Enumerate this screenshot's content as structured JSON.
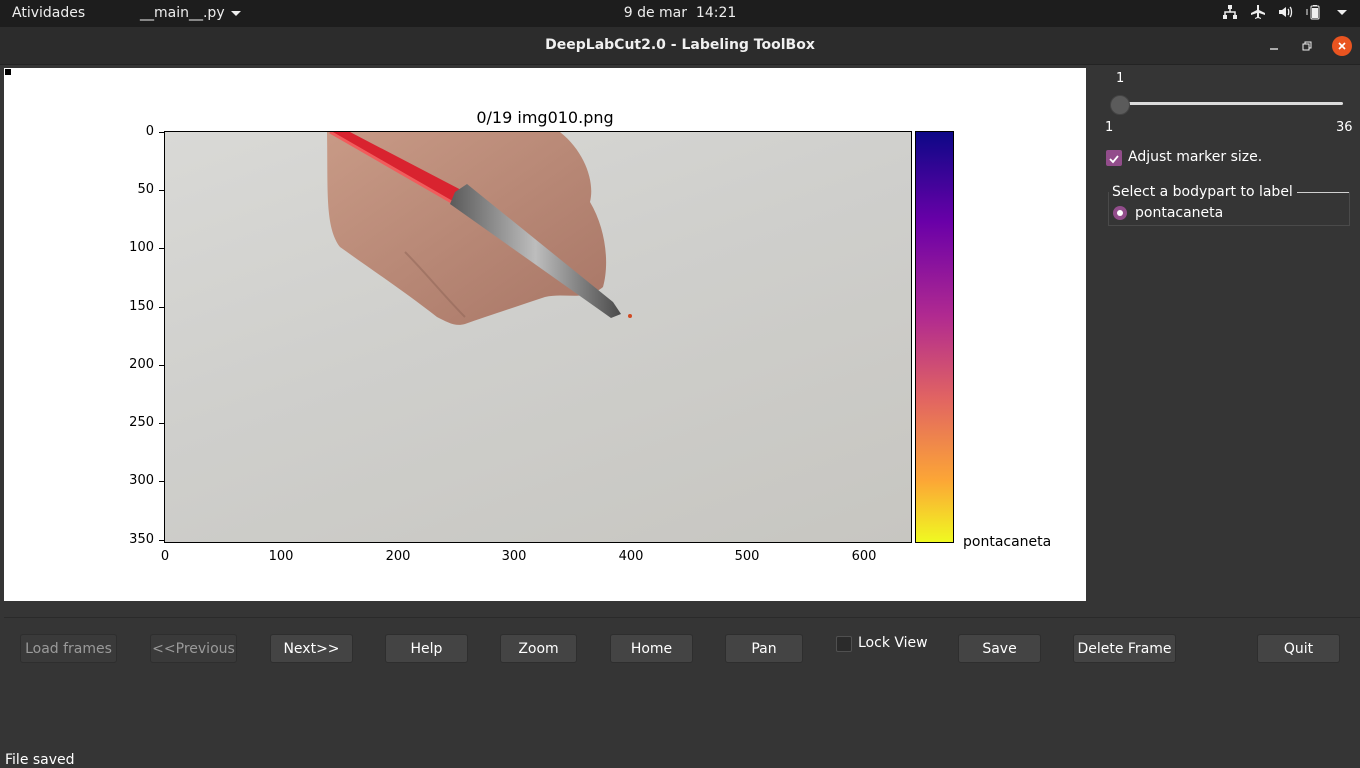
{
  "topbar": {
    "activities": "Atividades",
    "app_menu": "__main__.py",
    "date": "9 de mar",
    "time": "14:21",
    "tray_icons": [
      "network-icon",
      "airplane-icon",
      "volume-icon",
      "battery-icon",
      "system-menu-icon"
    ]
  },
  "window": {
    "title": "DeepLabCut2.0 - Labeling ToolBox"
  },
  "figure": {
    "title": "0/19 img010.png",
    "colorbar_label": "pontacaneta",
    "colormap": "plasma",
    "image_description_icon": "hand-with-pen-image"
  },
  "chart_data": {
    "type": "heatmap",
    "title": "0/19 img010.png",
    "xlabel": "",
    "ylabel": "",
    "x_ticks": [
      "0",
      "100",
      "200",
      "300",
      "400",
      "500",
      "600"
    ],
    "y_ticks": [
      "0",
      "50",
      "100",
      "150",
      "200",
      "250",
      "300",
      "350"
    ],
    "xlim": [
      0,
      640
    ],
    "ylim": [
      360,
      0
    ],
    "colorbar_labels": [
      "pontacaneta"
    ]
  },
  "side_panel": {
    "slider_value": "1",
    "slider_min": "1",
    "slider_max": "36",
    "slider_fraction": 0,
    "adjust_marker_label": "Adjust marker size.",
    "adjust_marker_checked": true,
    "bodypart_group_title": "Select a bodypart to label",
    "bodyparts": [
      {
        "label": "pontacaneta",
        "selected": true
      }
    ]
  },
  "buttons": {
    "load_frames": "Load frames",
    "previous": "<<Previous",
    "next": "Next>>",
    "help": "Help",
    "zoom": "Zoom",
    "home": "Home",
    "pan": "Pan",
    "lock_view": "Lock View",
    "save": "Save",
    "delete_frame": "Delete Frame",
    "quit": "Quit"
  },
  "status": {
    "text": "File saved"
  },
  "colors": {
    "accent": "#924d8b",
    "close": "#e95420"
  }
}
